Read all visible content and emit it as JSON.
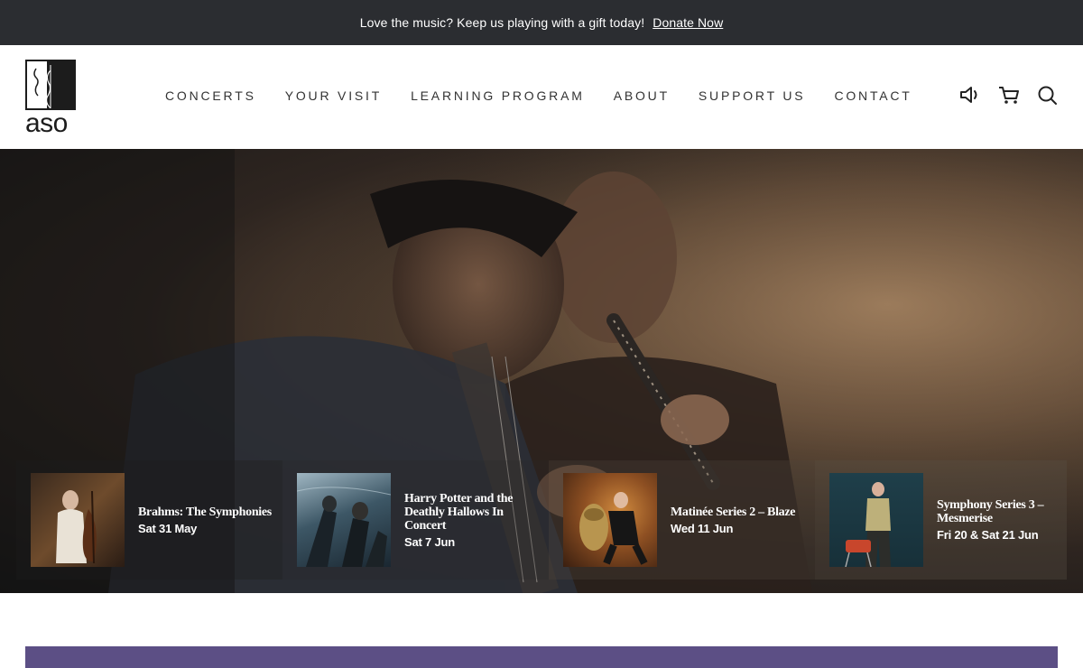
{
  "topbar": {
    "message": "Love the music? Keep us playing with a gift today!",
    "donate_label": "Donate Now"
  },
  "logo": {
    "text": "aso"
  },
  "nav": {
    "items": [
      {
        "label": "CONCERTS"
      },
      {
        "label": "YOUR VISIT"
      },
      {
        "label": "LEARNING PROGRAM"
      },
      {
        "label": "ABOUT"
      },
      {
        "label": "SUPPORT US"
      },
      {
        "label": "CONTACT"
      }
    ]
  },
  "header_icons": [
    "speaker-icon",
    "cart-icon",
    "search-icon"
  ],
  "events": [
    {
      "title": "Brahms: The Symphonies",
      "date": "Sat 31 May"
    },
    {
      "title": "Harry Potter and the Deathly Hallows In Concert",
      "date": "Sat 7 Jun"
    },
    {
      "title": "Matinée Series 2 – Blaze",
      "date": "Wed 11 Jun"
    },
    {
      "title": "Symphony Series 3 – Mesmerise",
      "date": "Fri 20 & Sat 21 Jun"
    }
  ],
  "colors": {
    "topbar_bg": "#2b2d31",
    "accent_purple": "#5c4f85"
  }
}
